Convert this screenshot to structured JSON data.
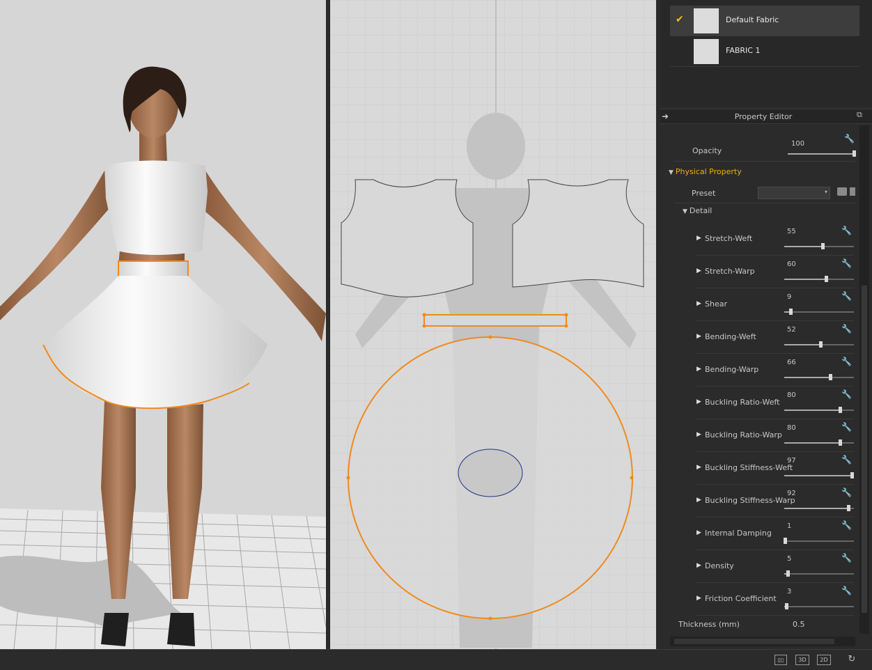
{
  "fabric_list": {
    "items": [
      {
        "name": "Default Fabric",
        "selected": true
      },
      {
        "name": "FABRIC 1",
        "selected": false
      }
    ]
  },
  "property_editor": {
    "title": "Property Editor",
    "opacity": {
      "label": "Opacity",
      "value": "100",
      "percent": 100
    },
    "physical_section": "Physical Property",
    "preset_label": "Preset",
    "detail_section": "Detail",
    "params": [
      {
        "label": "Stretch-Weft",
        "value": "55",
        "percent": 55
      },
      {
        "label": "Stretch-Warp",
        "value": "60",
        "percent": 60
      },
      {
        "label": "Shear",
        "value": "9",
        "percent": 9
      },
      {
        "label": "Bending-Weft",
        "value": "52",
        "percent": 52
      },
      {
        "label": "Bending-Warp",
        "value": "66",
        "percent": 66
      },
      {
        "label": "Buckling Ratio-Weft",
        "value": "80",
        "percent": 80
      },
      {
        "label": "Buckling Ratio-Warp",
        "value": "80",
        "percent": 80
      },
      {
        "label": "Buckling Stiffness-Weft",
        "value": "97",
        "percent": 97
      },
      {
        "label": "Buckling Stiffness-Warp",
        "value": "92",
        "percent": 92
      },
      {
        "label": "Internal Damping",
        "value": "1",
        "percent": 1
      },
      {
        "label": "Density",
        "value": "5",
        "percent": 5
      },
      {
        "label": "Friction Coefficient",
        "value": "3",
        "percent": 3
      }
    ],
    "thickness": {
      "label": "Thickness (mm)",
      "value": "0.5"
    }
  },
  "statusbar": {
    "view_3d": "3D",
    "view_2d": "2D"
  },
  "colors": {
    "selection_orange": "#f08a1c",
    "section_header": "#f0b400",
    "check": "#f0c020"
  }
}
